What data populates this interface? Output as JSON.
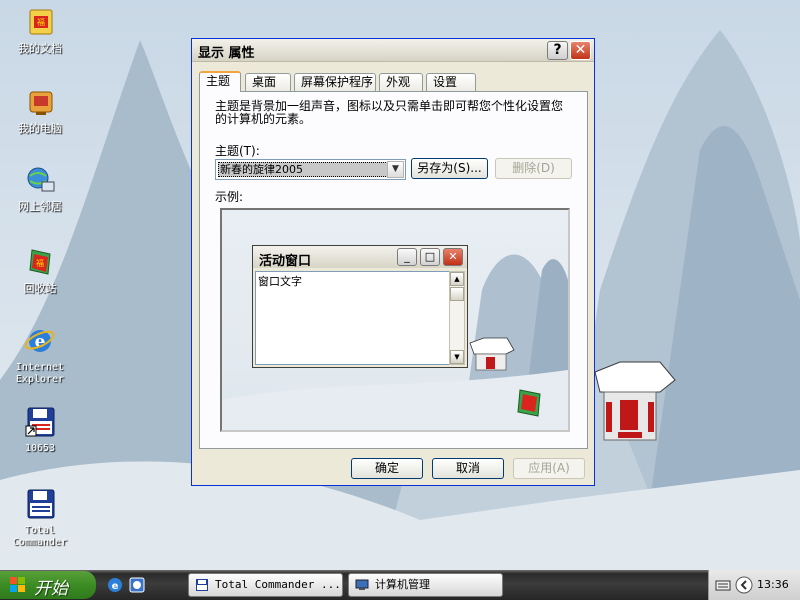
{
  "desktop": {
    "icons": [
      {
        "label": "我的文档",
        "icon": "my-documents-icon"
      },
      {
        "label": "我的电脑",
        "icon": "my-computer-icon"
      },
      {
        "label": "网上邻居",
        "icon": "network-places-icon"
      },
      {
        "label": "回收站",
        "icon": "recycle-bin-icon"
      },
      {
        "label": "Internet\nExplorer",
        "icon": "internet-explorer-icon"
      },
      {
        "label": "10653",
        "icon": "floppy-shortcut-icon"
      },
      {
        "label": "Total\nCommander",
        "icon": "total-commander-icon"
      }
    ]
  },
  "dialog": {
    "title": "显示 属性",
    "help_glyph": "?",
    "close_glyph": "✕",
    "tabs": [
      "主题",
      "桌面",
      "屏幕保护程序",
      "外观",
      "设置"
    ],
    "description": "主题是背景加一组声音，图标以及只需单击即可帮您个性化设置您的计算机的元素。",
    "theme_label": "主题(T):",
    "theme_value": "新春的旋律2005",
    "save_as_label": "另存为(S)...",
    "delete_label": "删除(D)",
    "sample_label": "示例:",
    "preview": {
      "window_title": "活动窗口",
      "window_text": "窗口文字",
      "min_glyph": "_",
      "max_glyph": "□",
      "close_glyph": "✕"
    },
    "ok_label": "确定",
    "cancel_label": "取消",
    "apply_label": "应用(A)"
  },
  "taskbar": {
    "start_label": "开始",
    "tasks": [
      {
        "label": "Total Commander ...",
        "icon": "total-commander-icon"
      },
      {
        "label": "计算机管理",
        "icon": "computer-management-icon"
      }
    ],
    "clock": "13:36"
  }
}
